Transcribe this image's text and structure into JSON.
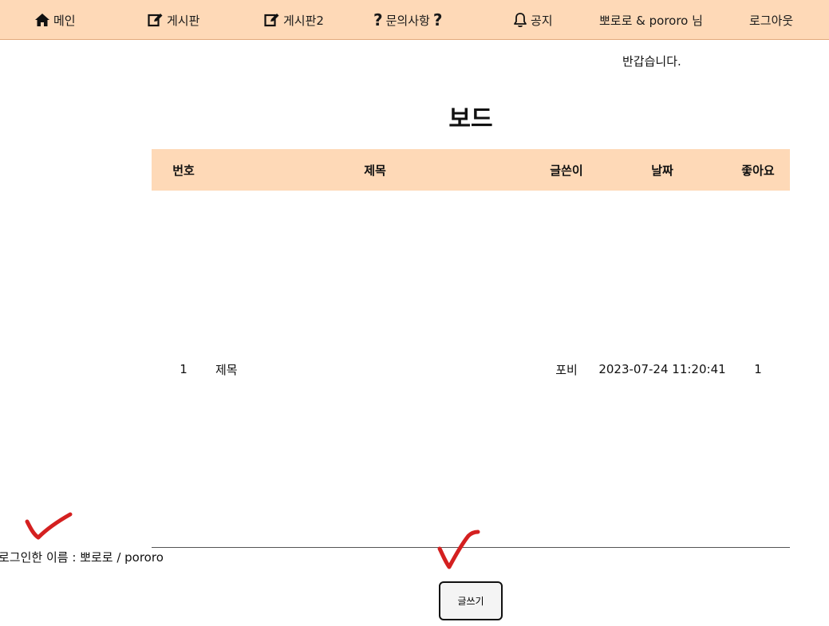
{
  "nav": {
    "items": [
      {
        "label": "메인",
        "icon": "home-icon"
      },
      {
        "label": "게시판",
        "icon": "edit-icon"
      },
      {
        "label": "게시판2",
        "icon": "edit-icon"
      },
      {
        "label": "문의사항",
        "icon": "question-icon"
      },
      {
        "label": "공지",
        "icon": "bell-icon"
      },
      {
        "label": "뽀로로 & pororo 님"
      },
      {
        "label": "로그아웃"
      }
    ],
    "background": "#fed9b7"
  },
  "welcome": "반갑습니다.",
  "page_title": "보드",
  "table": {
    "headers": [
      "번호",
      "제목",
      "글쓴이",
      "날짜",
      "좋아요"
    ],
    "rows": [
      {
        "no": "1",
        "title": "제목",
        "author": "포비",
        "date": "2023-07-24 11:20:41",
        "likes": "1"
      }
    ]
  },
  "login_name": "로그인한 이름 : 뽀로로 / pororo",
  "write_button": "글쓰기",
  "annotation_color": "#d42020"
}
